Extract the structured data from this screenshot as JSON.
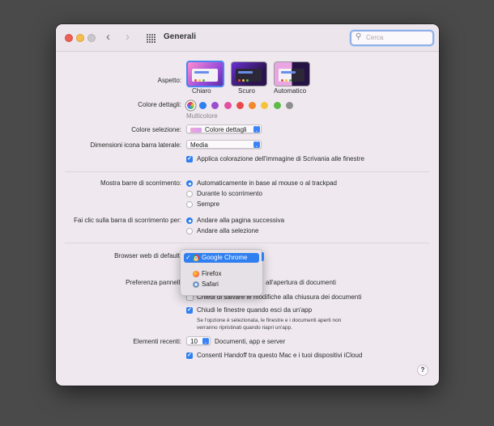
{
  "window": {
    "title": "Generali"
  },
  "search": {
    "placeholder": "Cerca"
  },
  "appearance": {
    "label": "Aspetto:",
    "options": [
      {
        "name": "Chiaro",
        "selected": true
      },
      {
        "name": "Scuro",
        "selected": false
      },
      {
        "name": "Automatico",
        "selected": false
      }
    ]
  },
  "accent": {
    "label": "Colore dettagli:",
    "selected_name": "Multicolore",
    "colors": [
      "multicolor",
      "#2f7ff0",
      "#9b4fd0",
      "#e2509f",
      "#e84a4a",
      "#f08a2c",
      "#f5c33b",
      "#5cba47",
      "#8e8e8e"
    ]
  },
  "highlight": {
    "label": "Colore selezione:",
    "value": "Colore dettagli"
  },
  "sidebar_icon": {
    "label": "Dimensioni icona barra laterale:",
    "value": "Media"
  },
  "wallpaper_tint": {
    "label": "Applica colorazione dell'immagine di Scrivania alle finestre",
    "checked": true
  },
  "scrollbars": {
    "label": "Mostra barre di scorrimento:",
    "options": [
      {
        "text": "Automaticamente in base al mouse o al trackpad",
        "selected": true
      },
      {
        "text": "Durante lo scorrimento",
        "selected": false
      },
      {
        "text": "Sempre",
        "selected": false
      }
    ]
  },
  "click_scrollbar": {
    "label": "Fai clic sulla barra di scorrimento per:",
    "options": [
      {
        "text": "Andare alla pagina successiva",
        "selected": true
      },
      {
        "text": "Andare alla selezione",
        "selected": false
      }
    ]
  },
  "browser": {
    "label": "Browser web di default",
    "menu": [
      {
        "name": "Google Chrome",
        "selected": true,
        "icon": "chrome-icon"
      },
      {
        "name": "Firefox",
        "selected": false,
        "icon": "firefox-icon"
      },
      {
        "name": "Safari",
        "selected": false,
        "icon": "safari-icon"
      }
    ]
  },
  "tabs_pref": {
    "label": "Preferenza pannelli",
    "value_suffix": "all'apertura di documenti"
  },
  "ask_save": {
    "label": "Chiedi di salvare le modifiche alla chiusura dei documenti",
    "checked": false
  },
  "close_windows": {
    "label": "Chiudi le finestre quando esci da un'app",
    "checked": true,
    "note_line1": "Se l'opzione è selezionata, le finestre e i documenti aperti non",
    "note_line2": "verranno ripristinati quando riapri un'app."
  },
  "recent": {
    "label": "Elementi recenti:",
    "value": "10",
    "suffix": "Documenti, app e server"
  },
  "handoff": {
    "label": "Consenti Handoff tra questo Mac e i tuoi dispositivi iCloud",
    "checked": true
  },
  "help": {
    "label": "?"
  }
}
